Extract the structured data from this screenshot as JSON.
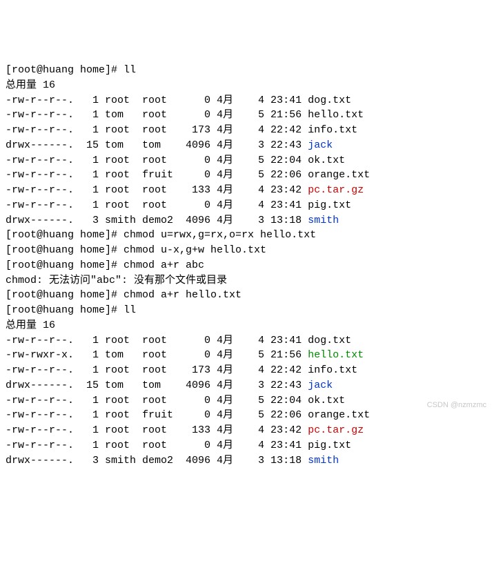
{
  "prompt_prefix": "[root@huang home]# ",
  "cmd1": "ll",
  "total1": "总用量 16",
  "ls1": [
    {
      "perm": "-rw-r--r--.",
      "links": "  1",
      "owner": "root ",
      "group": "root ",
      "size": "    0",
      "month": "4月",
      "day": "   4",
      "time": "23:41",
      "name": "dog.txt",
      "cls": ""
    },
    {
      "perm": "-rw-r--r--.",
      "links": "  1",
      "owner": "tom  ",
      "group": "root ",
      "size": "    0",
      "month": "4月",
      "day": "   5",
      "time": "21:56",
      "name": "hello.txt",
      "cls": ""
    },
    {
      "perm": "-rw-r--r--.",
      "links": "  1",
      "owner": "root ",
      "group": "root ",
      "size": "  173",
      "month": "4月",
      "day": "   4",
      "time": "22:42",
      "name": "info.txt",
      "cls": ""
    },
    {
      "perm": "drwx------.",
      "links": " 15",
      "owner": "tom  ",
      "group": "tom  ",
      "size": " 4096",
      "month": "4月",
      "day": "   3",
      "time": "22:43",
      "name": "jack",
      "cls": "blue"
    },
    {
      "perm": "-rw-r--r--.",
      "links": "  1",
      "owner": "root ",
      "group": "root ",
      "size": "    0",
      "month": "4月",
      "day": "   5",
      "time": "22:04",
      "name": "ok.txt",
      "cls": ""
    },
    {
      "perm": "-rw-r--r--.",
      "links": "  1",
      "owner": "root ",
      "group": "fruit",
      "size": "    0",
      "month": "4月",
      "day": "   5",
      "time": "22:06",
      "name": "orange.txt",
      "cls": ""
    },
    {
      "perm": "-rw-r--r--.",
      "links": "  1",
      "owner": "root ",
      "group": "root ",
      "size": "  133",
      "month": "4月",
      "day": "   4",
      "time": "23:42",
      "name": "pc.tar.gz",
      "cls": "red"
    },
    {
      "perm": "-rw-r--r--.",
      "links": "  1",
      "owner": "root ",
      "group": "root ",
      "size": "    0",
      "month": "4月",
      "day": "   4",
      "time": "23:41",
      "name": "pig.txt",
      "cls": ""
    },
    {
      "perm": "drwx------.",
      "links": "  3",
      "owner": "smith",
      "group": "demo2",
      "size": " 4096",
      "month": "4月",
      "day": "   3",
      "time": "13:18",
      "name": "smith",
      "cls": "blue"
    }
  ],
  "cmd2": "chmod u=rwx,g=rx,o=rx hello.txt",
  "cmd3": "chmod u-x,g+w hello.txt",
  "cmd4": "chmod a+r abc",
  "err4": "chmod: 无法访问\"abc\": 没有那个文件或目录",
  "cmd5": "chmod a+r hello.txt",
  "cmd6": "ll",
  "total2": "总用量 16",
  "ls2": [
    {
      "perm": "-rw-r--r--.",
      "links": "  1",
      "owner": "root ",
      "group": "root ",
      "size": "    0",
      "month": "4月",
      "day": "   4",
      "time": "23:41",
      "name": "dog.txt",
      "cls": ""
    },
    {
      "perm": "-rw-rwxr-x.",
      "links": "  1",
      "owner": "tom  ",
      "group": "root ",
      "size": "    0",
      "month": "4月",
      "day": "   5",
      "time": "21:56",
      "name": "hello.txt",
      "cls": "green"
    },
    {
      "perm": "-rw-r--r--.",
      "links": "  1",
      "owner": "root ",
      "group": "root ",
      "size": "  173",
      "month": "4月",
      "day": "   4",
      "time": "22:42",
      "name": "info.txt",
      "cls": ""
    },
    {
      "perm": "drwx------.",
      "links": " 15",
      "owner": "tom  ",
      "group": "tom  ",
      "size": " 4096",
      "month": "4月",
      "day": "   3",
      "time": "22:43",
      "name": "jack",
      "cls": "blue"
    },
    {
      "perm": "-rw-r--r--.",
      "links": "  1",
      "owner": "root ",
      "group": "root ",
      "size": "    0",
      "month": "4月",
      "day": "   5",
      "time": "22:04",
      "name": "ok.txt",
      "cls": ""
    },
    {
      "perm": "-rw-r--r--.",
      "links": "  1",
      "owner": "root ",
      "group": "fruit",
      "size": "    0",
      "month": "4月",
      "day": "   5",
      "time": "22:06",
      "name": "orange.txt",
      "cls": ""
    },
    {
      "perm": "-rw-r--r--.",
      "links": "  1",
      "owner": "root ",
      "group": "root ",
      "size": "  133",
      "month": "4月",
      "day": "   4",
      "time": "23:42",
      "name": "pc.tar.gz",
      "cls": "red"
    },
    {
      "perm": "-rw-r--r--.",
      "links": "  1",
      "owner": "root ",
      "group": "root ",
      "size": "    0",
      "month": "4月",
      "day": "   4",
      "time": "23:41",
      "name": "pig.txt",
      "cls": ""
    },
    {
      "perm": "drwx------.",
      "links": "  3",
      "owner": "smith",
      "group": "demo2",
      "size": " 4096",
      "month": "4月",
      "day": "   3",
      "time": "13:18",
      "name": "smith",
      "cls": "blue"
    }
  ],
  "watermark": "CSDN @nzmzmc"
}
